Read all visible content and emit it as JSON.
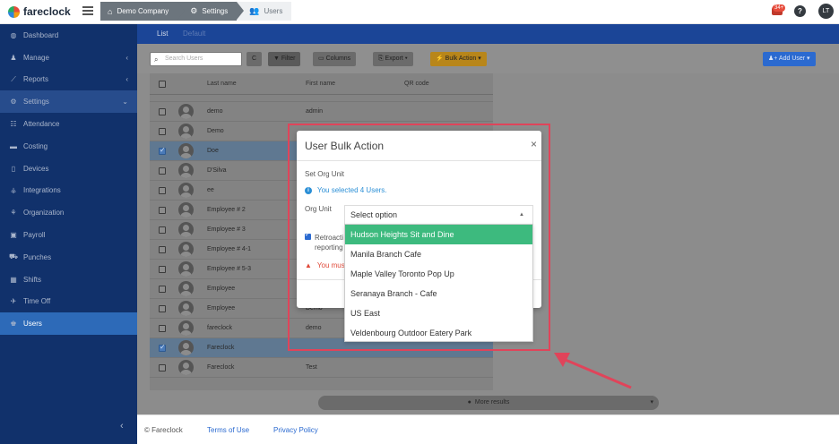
{
  "app": {
    "brand": "fareclock",
    "breadcrumbs": [
      "Demo Company",
      "Settings",
      "Users"
    ],
    "notification_count": "34+",
    "help_glyph": "?",
    "user_initials": "LT"
  },
  "sidebar": {
    "items": [
      {
        "label": "Dashboard",
        "icon": "dashboard-icon"
      },
      {
        "label": "Manage",
        "icon": "person-icon",
        "chevron": "‹"
      },
      {
        "label": "Reports",
        "icon": "chart-icon",
        "chevron": "‹"
      },
      {
        "label": "Settings",
        "icon": "gear-icon",
        "chevron": "⌄"
      },
      {
        "label": "Attendance",
        "icon": "attendance-icon"
      },
      {
        "label": "Costing",
        "icon": "folder-icon"
      },
      {
        "label": "Devices",
        "icon": "device-icon"
      },
      {
        "label": "Integrations",
        "icon": "plug-icon"
      },
      {
        "label": "Organization",
        "icon": "org-icon"
      },
      {
        "label": "Payroll",
        "icon": "money-icon"
      },
      {
        "label": "Punches",
        "icon": "punch-icon"
      },
      {
        "label": "Shifts",
        "icon": "calendar-icon"
      },
      {
        "label": "Time Off",
        "icon": "plane-icon"
      },
      {
        "label": "Users",
        "icon": "users-icon"
      }
    ],
    "collapse_glyph": "‹"
  },
  "tabs": {
    "list": "List",
    "default": "Default"
  },
  "toolbar": {
    "search_placeholder": "Search Users",
    "refresh": "C",
    "filter": "Filter",
    "columns": "Columns",
    "export": "Export ▾",
    "bulk_action": "Bulk Action ▾",
    "add_user": "Add User ▾"
  },
  "table": {
    "headers": {
      "last": "Last name",
      "first": "First name",
      "qr": "QR code"
    },
    "rows": [
      {
        "last": "demo",
        "first": "admin",
        "checked": false
      },
      {
        "last": "Demo",
        "first": "",
        "checked": false
      },
      {
        "last": "Doe",
        "first": "",
        "checked": true
      },
      {
        "last": "D'Silva",
        "first": "",
        "checked": false
      },
      {
        "last": "ee",
        "first": "",
        "checked": false
      },
      {
        "last": "Employee # 2",
        "first": "",
        "checked": false
      },
      {
        "last": "Employee # 3",
        "first": "",
        "checked": false
      },
      {
        "last": "Employee # 4-1",
        "first": "",
        "checked": false
      },
      {
        "last": "Employee # 5-3",
        "first": "",
        "checked": false
      },
      {
        "last": "Employee",
        "first": "",
        "checked": false
      },
      {
        "last": "Employee",
        "first": "Demo",
        "checked": false
      },
      {
        "last": "fareclock",
        "first": "demo",
        "checked": false
      },
      {
        "last": "Fareclock",
        "first": "",
        "checked": true
      },
      {
        "last": "Fareclock",
        "first": "Test",
        "checked": false
      }
    ],
    "more_results": "More results"
  },
  "footer": {
    "copyright": "© Fareclock",
    "terms": "Terms of Use",
    "privacy": "Privacy Policy"
  },
  "modal": {
    "title": "User Bulk Action",
    "close": "×",
    "section_label": "Set Org Unit",
    "info": "You selected 4 Users.",
    "org_unit_label": "Org Unit",
    "retro_label_line1": "Retroacti",
    "retro_label_line2": "reporting",
    "warning": "You mus"
  },
  "select": {
    "placeholder": "Select option",
    "caret": "▲",
    "options": [
      "Hudson Heights Sit and Dine",
      "Manila Branch Cafe",
      "Maple Valley Toronto Pop Up",
      "Seranaya Branch - Cafe",
      "US East",
      "Veldenbourg Outdoor Eatery Park"
    ]
  },
  "colors": {
    "sidebar": "#11316b",
    "accent": "#1b4597",
    "highlight_option": "#3dba7e",
    "annotation": "#e0445a"
  }
}
